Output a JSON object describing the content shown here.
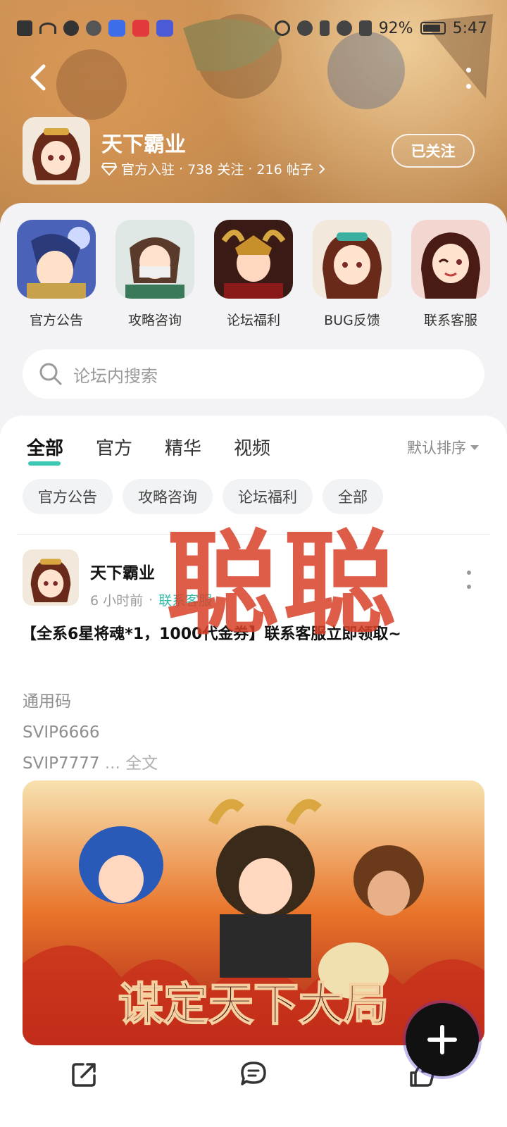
{
  "status_bar": {
    "battery": "92%",
    "time": "5:47"
  },
  "forum": {
    "title": "天下霸业",
    "verified_label": "官方入驻",
    "followers": "738 关注",
    "posts": "216 帖子",
    "follow_button": "已关注"
  },
  "shortcuts": [
    {
      "label": "官方公告"
    },
    {
      "label": "攻略咨询"
    },
    {
      "label": "论坛福利"
    },
    {
      "label": "BUG反馈"
    },
    {
      "label": "联系客服"
    }
  ],
  "search": {
    "placeholder": "论坛内搜索"
  },
  "tabs": [
    {
      "label": "全部",
      "active": true
    },
    {
      "label": "官方"
    },
    {
      "label": "精华"
    },
    {
      "label": "视频"
    }
  ],
  "sort_label": "默认排序",
  "chips": [
    "官方公告",
    "攻略咨询",
    "论坛福利",
    "全部"
  ],
  "post": {
    "author": "天下霸业",
    "time": "6 小时前",
    "tag": "联系客服",
    "title": "【全系6星将魂*1，1000代金券】联系客服立即领取~",
    "body_lines": [
      "通用码",
      "SVIP6666",
      "SVIP7777"
    ],
    "more_label": "... 全文",
    "image_text": "谋定天下大局"
  },
  "watermark": "聪聪",
  "colors": {
    "accent": "#3cc8b4",
    "banner": "#c48a4e",
    "watermark": "#d74128"
  }
}
